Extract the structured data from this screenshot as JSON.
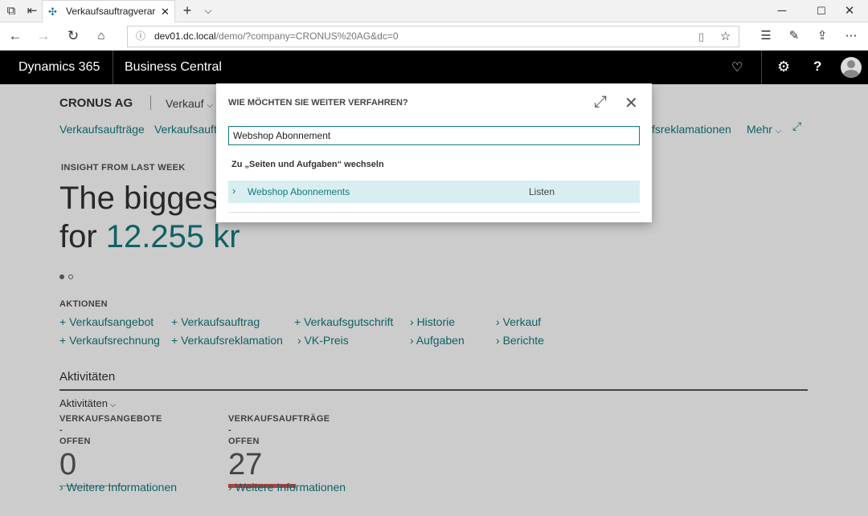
{
  "browser": {
    "tab_title": "Verkaufsauftragverarbei",
    "url_host": "dev01.dc.local",
    "url_path": "/demo/?company=CRONUS%20AG&dc=0"
  },
  "app": {
    "brand": "Dynamics 365",
    "product": "Business Central"
  },
  "page": {
    "company": "CRONUS AG",
    "role_menu": "Verkauf",
    "nav_links": [
      "Verkaufsaufträge",
      "Verkaufsaufträ",
      "fsreklamationen",
      "Mehr"
    ],
    "insight_label": "INSIGHT FROM LAST WEEK",
    "headline_line1": "The biggest",
    "headline_line2_prefix": "for ",
    "headline_amount": "12.255 kr",
    "actions_label": "AKTIONEN",
    "actions": {
      "col1": [
        "Verkaufsangebot",
        "Verkaufsrechnung"
      ],
      "col2": [
        "Verkaufsauftrag",
        "Verkaufsreklamation"
      ],
      "col3": [
        "Verkaufsgutschrift",
        "VK-Preis"
      ],
      "col4": [
        "Historie",
        "Aufgaben"
      ],
      "col5": [
        "Verkauf",
        "Berichte"
      ]
    },
    "activities_title": "Aktivitäten",
    "activities_group": "Aktivitäten",
    "cue1": {
      "label_line1": "VERKAUFSANGEBOTE -",
      "label_line2": "OFFEN",
      "value": "0",
      "more": "Weitere Informationen"
    },
    "cue2": {
      "label_line1": "VERKAUFSAUFTRÄGE -",
      "label_line2": "OFFEN",
      "value": "27",
      "more": "Weitere Informationen"
    }
  },
  "dialog": {
    "title": "WIE MÖCHTEN SIE WEITER VERFAHREN?",
    "search_value": "Webshop Abonnement",
    "section_heading": "Zu „Seiten und Aufgaben“ wechseln",
    "result_name": "Webshop Abonnements",
    "result_category": "Listen"
  },
  "colors": {
    "accent": "#137a7f",
    "header_bg": "#000000",
    "highlight_row": "#d8eef0",
    "cue_bar_red": "#d9534f"
  }
}
